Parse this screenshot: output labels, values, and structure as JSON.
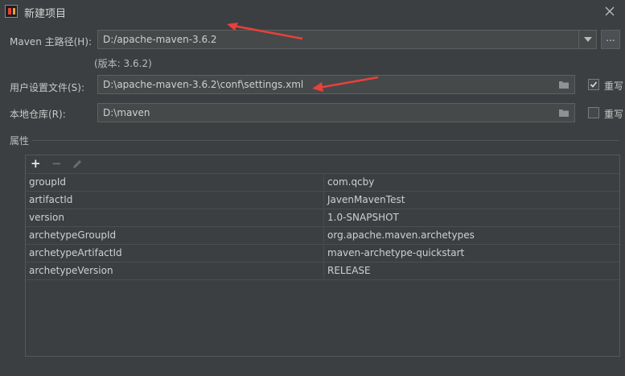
{
  "window": {
    "title": "新建项目"
  },
  "maven_home": {
    "label": "Maven 主路径(H):",
    "value": "D:/apache-maven-3.6.2",
    "browse_label": "...",
    "version_note": "(版本: 3.6.2)"
  },
  "user_settings": {
    "label": "用户设置文件(S):",
    "value": "D:\\apache-maven-3.6.2\\conf\\settings.xml",
    "override_label": "重写",
    "override_checked": true
  },
  "local_repo": {
    "label": "本地仓库(R):",
    "value": "D:\\maven",
    "override_label": "重写",
    "override_checked": false
  },
  "properties": {
    "title": "属性",
    "toolbar": {
      "add": "+",
      "remove": "−"
    },
    "rows": [
      {
        "key": "groupId",
        "value": "com.qcby"
      },
      {
        "key": "artifactId",
        "value": "JavenMavenTest"
      },
      {
        "key": "version",
        "value": "1.0-SNAPSHOT"
      },
      {
        "key": "archetypeGroupId",
        "value": "org.apache.maven.archetypes"
      },
      {
        "key": "archetypeArtifactId",
        "value": "maven-archetype-quickstart"
      },
      {
        "key": "archetypeVersion",
        "value": "RELEASE"
      }
    ]
  }
}
